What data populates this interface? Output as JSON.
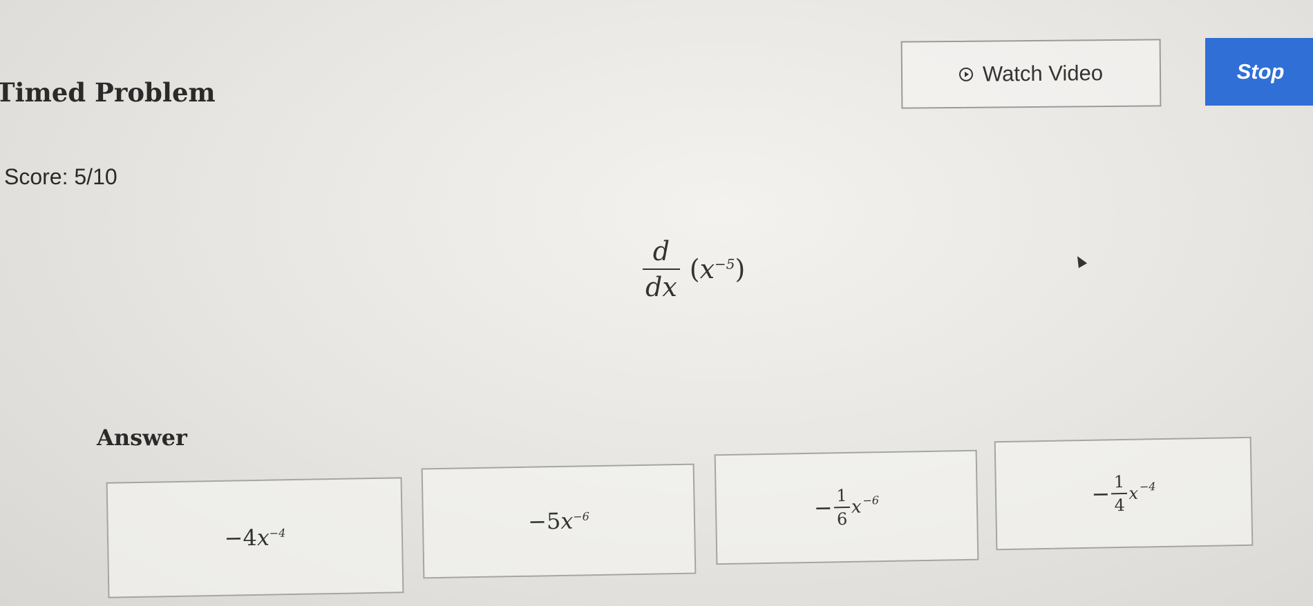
{
  "header": {
    "title": "Timed Problem",
    "watch_video_label": "Watch Video",
    "stop_label": "Stop"
  },
  "score": {
    "text": "Score: 5/10"
  },
  "question": {
    "numerator": "d",
    "denominator": "dx",
    "base": "x",
    "exponent": "−5"
  },
  "answer": {
    "label": "Answer",
    "choices": [
      {
        "sign": "−",
        "coef": "4",
        "var": "x",
        "exp": "−4"
      },
      {
        "sign": "−",
        "coef": "5",
        "var": "x",
        "exp": "−6"
      },
      {
        "sign": "−",
        "num": "1",
        "den": "6",
        "var": "x",
        "exp": "−6"
      },
      {
        "sign": "−",
        "num": "1",
        "den": "4",
        "var": "x",
        "exp": "−4"
      }
    ]
  },
  "icons": {
    "watch_video": "play-circle-icon",
    "cursor": "mouse-pointer-icon"
  },
  "colors": {
    "stop_button": "#2f6fd6"
  }
}
